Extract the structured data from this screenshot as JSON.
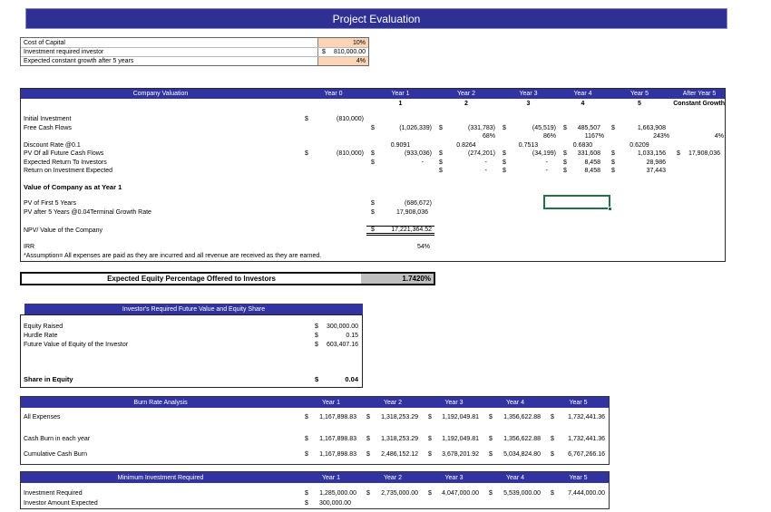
{
  "title": "Project Evaluation",
  "currency": "$",
  "colors": {
    "banner_navy": "#2E3093",
    "header_navy": "#3133A0",
    "input_orange": "#FBD5B5",
    "result_gray": "#BFBFBF",
    "selection_green": "#217346"
  },
  "assumptions": {
    "rows": [
      {
        "label": "Cost of Capital",
        "value": "10%"
      },
      {
        "label": "Investment required investor",
        "value": "810,000.00"
      },
      {
        "label": "Expected constant growth after 5 years",
        "value": "4%"
      }
    ]
  },
  "valuation": {
    "title": "Company Valuation",
    "col_headers": [
      "Year 0",
      "Year 1",
      "Year 2",
      "Year 3",
      "Year 4",
      "Year 5",
      "After Year 5"
    ],
    "periods": [
      "1",
      "2",
      "3",
      "4",
      "5"
    ],
    "constant_growth": "Constant Growth",
    "initial_investment": {
      "label": "Initial Investment",
      "y0": "(810,000)"
    },
    "fcf": {
      "label": "Free Cash Flows",
      "y1": "(1,026,339)",
      "y2": "(331,783)",
      "y3": "(45,519)",
      "y4": "485,507",
      "y5": "1,663,908"
    },
    "fcf_growth": {
      "y2": "68%",
      "y3": "86%",
      "y4": "1167%",
      "y5": "243%",
      "after": "4%"
    },
    "discount": {
      "label": "Discount Rate @0.1",
      "y1": "0.9091",
      "y2": "0.8264",
      "y3": "0.7513",
      "y4": "0.6830",
      "y5": "0.6209"
    },
    "pv_all": {
      "label": "PV Of all Future Cash Flows",
      "y0": "(810,000)",
      "y1": "(933,036)",
      "y2": "(274,201)",
      "y3": "(34,199)",
      "y4": "331,608",
      "y5": "1,033,156",
      "after": "17,908,036"
    },
    "expected_return": {
      "label": "Expected Return To Investors",
      "y1": "-",
      "y2": "-",
      "y3": "-",
      "y4": "8,458",
      "y5": "28,986"
    },
    "roi_expected": {
      "label": "Return on Investment Expected",
      "y2": "-",
      "y3": "-",
      "y4": "8,458",
      "y5": "37,443"
    },
    "section_title": "Value of Company as at Year 1",
    "pv_first5": {
      "label": "PV of First 5 Years",
      "y1": "(686,672)"
    },
    "pv_after5": {
      "label": "PV after 5 Years @0.04Terminal Growth Rate",
      "y1": "17,908,036"
    },
    "npv": {
      "label": "NPV/ Value of the Company",
      "y1": "17,221,364.52"
    },
    "irr": {
      "label": "IRR",
      "y1": "54%"
    },
    "note": "*Assumption= All expenses are paid as they are incurred and all revenue are received as they are earned."
  },
  "equity_offer": {
    "label": "Expected Equity Percentage Offered to Investors",
    "value": "1.7420%"
  },
  "investor": {
    "title": "Investor's Required Future Value and Equity Share",
    "rows": [
      {
        "label": "Equity Raised",
        "value": "300,000.00"
      },
      {
        "label": "Hurdle Rate",
        "value": "0.15"
      },
      {
        "label": "Future Value of Equity of the Investor",
        "value": "603,407.16"
      }
    ],
    "total": {
      "label": "Share in Equity",
      "value": "0.04"
    }
  },
  "burn_rate": {
    "title": "Burn Rate Analysis",
    "col_headers": [
      "Year 1",
      "Year 2",
      "Year 3",
      "Year 4",
      "Year 5"
    ],
    "rows": [
      {
        "label": "All Expenses",
        "values": [
          "1,167,898.83",
          "1,318,253.29",
          "1,192,049.81",
          "1,356,622.88",
          "1,732,441.36"
        ]
      },
      {
        "label": "Cash Burn in each year",
        "values": [
          "1,167,898.83",
          "1,318,253.29",
          "1,192,049.81",
          "1,356,622.88",
          "1,732,441.36"
        ]
      },
      {
        "label": "Cumulative Cash Burn",
        "values": [
          "1,167,898.83",
          "2,486,152.12",
          "3,678,201.92",
          "5,034,824.80",
          "6,767,266.16"
        ]
      }
    ]
  },
  "min_investment": {
    "title": "Minimum Investment Required",
    "col_headers": [
      "Year 1",
      "Year 2",
      "Year 3",
      "Year 4",
      "Year 5"
    ],
    "rows": [
      {
        "label": "Investment Required",
        "values": [
          "1,285,000.00",
          "2,735,000.00",
          "4,047,000.00",
          "5,539,000.00",
          "7,444,000.00"
        ]
      },
      {
        "label": "Investor Amount Expected",
        "values": [
          "300,000.00",
          "",
          "",
          "",
          ""
        ]
      }
    ]
  }
}
